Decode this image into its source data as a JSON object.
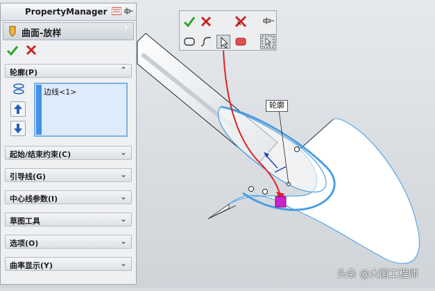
{
  "property_manager": {
    "title": "PropertyManager",
    "feature_name": "曲面-放样",
    "help_glyph": "?",
    "sections": {
      "profile": {
        "label": "轮廓(P)",
        "items": [
          "边线<1>"
        ]
      },
      "start_end": {
        "label": "起始/结束约束(C)"
      },
      "guide": {
        "label": "引导线(G)"
      },
      "centerline": {
        "label": "中心线参数(I)"
      },
      "sketch_tools": {
        "label": "草图工具"
      },
      "options": {
        "label": "选项(O)"
      },
      "curvature": {
        "label": "曲率显示(Y)"
      }
    }
  },
  "viewport": {
    "callout_label": "轮廓",
    "watermark": "头条 @大国工程师"
  },
  "colors": {
    "ok_green": "#2aa52a",
    "cancel_red": "#d02020",
    "edge_blue": "#4a9de0",
    "arrow_red": "#e02020",
    "select_magenta": "#cc22cc"
  }
}
